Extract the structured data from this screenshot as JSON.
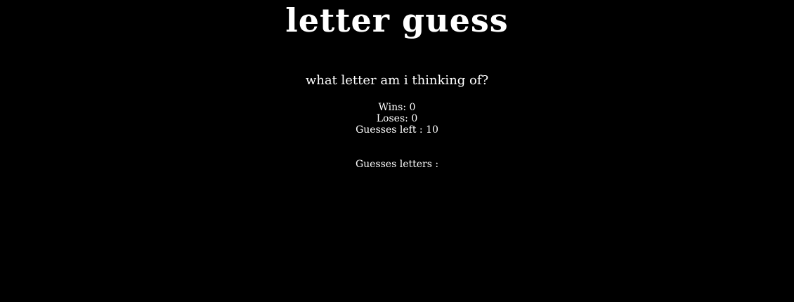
{
  "game": {
    "title": "letter guess",
    "prompt": "what letter am i thinking of?",
    "wins_label": "Wins:",
    "wins_value": "0",
    "loses_label": "Loses:",
    "loses_value": "0",
    "guesses_left_label": "Guesses left :",
    "guesses_left_value": "10",
    "guessed_letters_label": "Guesses letters :",
    "guessed_letters_value": ""
  },
  "colors": {
    "background": "#000000",
    "text": "#ffffff"
  }
}
